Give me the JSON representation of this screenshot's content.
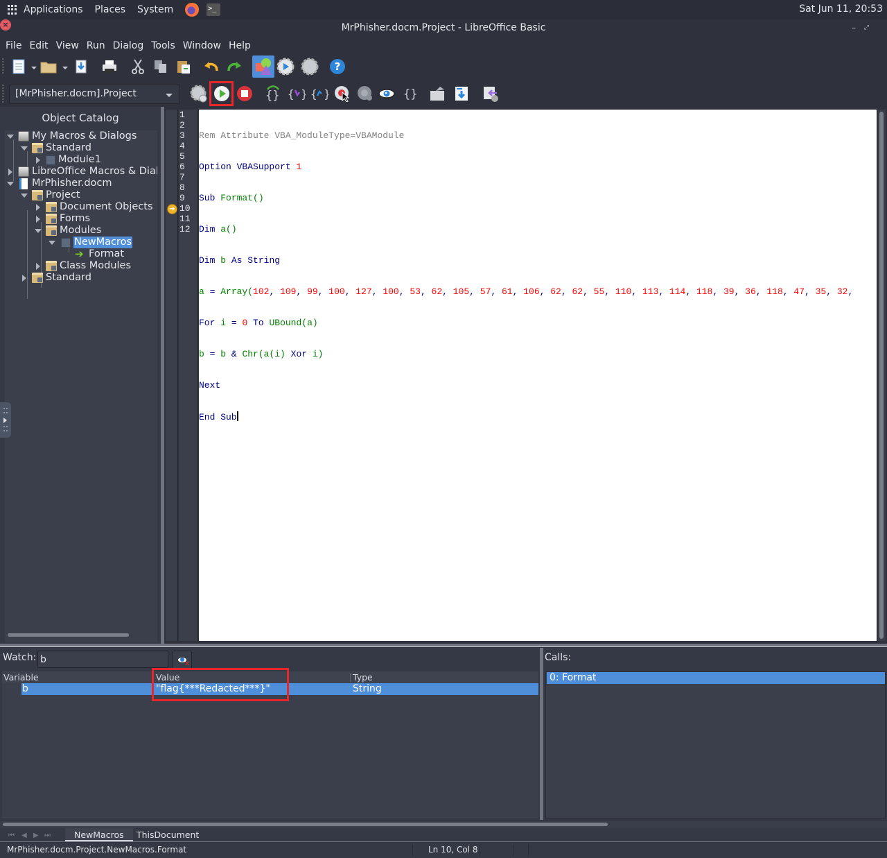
{
  "top_panel": {
    "menus": [
      "Applications",
      "Places",
      "System"
    ],
    "clock": "Sat Jun 11, 20:53"
  },
  "window": {
    "title": "MrPhisher.docm.Project - LibreOffice Basic",
    "minimize": "–",
    "maximize": "⤢",
    "close": "×"
  },
  "menubar": [
    "File",
    "Edit",
    "View",
    "Run",
    "Dialog",
    "Tools",
    "Window",
    "Help"
  ],
  "toolbar2": {
    "library_selected": "[MrPhisher.docm].Project"
  },
  "catalog": {
    "title": "Object Catalog",
    "nodes": [
      {
        "label": "My Macros & Dialogs",
        "state": "open",
        "icon": "drive-icon"
      },
      {
        "label": "Standard",
        "state": "open",
        "icon": "library-folder-icon"
      },
      {
        "label": "Module1",
        "state": "closed",
        "icon": "module-icon"
      },
      {
        "label": "LibreOffice Macros & Dialo",
        "state": "closed",
        "icon": "drive-icon"
      },
      {
        "label": "MrPhisher.docm",
        "state": "open",
        "icon": "document-icon"
      },
      {
        "label": "Project",
        "state": "open",
        "icon": "library-folder-icon"
      },
      {
        "label": "Document Objects",
        "state": "closed",
        "icon": "library-folder-icon"
      },
      {
        "label": "Forms",
        "state": "closed",
        "icon": "library-folder-icon"
      },
      {
        "label": "Modules",
        "state": "open",
        "icon": "library-folder-icon"
      },
      {
        "label": "NewMacros",
        "state": "open",
        "icon": "module-icon",
        "selected": true
      },
      {
        "label": "Format",
        "state": "leaf",
        "icon": "macro-arrow-icon"
      },
      {
        "label": "Class Modules",
        "state": "closed",
        "icon": "library-folder-icon"
      },
      {
        "label": "Standard",
        "state": "closed",
        "icon": "library-folder-icon"
      }
    ]
  },
  "editor": {
    "line_numbers": [
      "1",
      "2",
      "3",
      "4",
      "5",
      "6",
      "7",
      "8",
      "9",
      "10",
      "11",
      "12"
    ],
    "current_line": 10,
    "array_values": [
      102,
      109,
      99,
      100,
      127,
      100,
      53,
      62,
      105,
      57,
      61,
      106,
      62,
      62,
      55,
      110,
      113,
      114,
      118,
      39,
      36,
      118,
      47,
      35,
      32
    ],
    "tokens": {
      "l1": "Rem Attribute VBA_ModuleType=VBAModule",
      "l2_kw": "Option VBASupport ",
      "l2_num": "1",
      "l3_kw": "Sub ",
      "l3_id": "Format()",
      "l4_kw": "Dim ",
      "l4_id": "a()",
      "l5_kw": "Dim ",
      "l5_id": "b",
      "l5_kw2": " As String",
      "l6_id": "a",
      "l6_op": " = ",
      "l6_fn": "Array(",
      "l7_kw": "For ",
      "l7_id": "i",
      "l7_op": " = ",
      "l7_num": "0",
      "l7_kw2": " To ",
      "l7_fn": "UBound(a)",
      "l8_id": "b",
      "l8_op": " = ",
      "l8_id2": "b",
      "l8_op2": " & ",
      "l8_fn": "Chr(a(i) ",
      "l8_kw": "Xor",
      "l8_fn2": " i)",
      "l9_kw": "Next",
      "l10_kw": "End Sub"
    }
  },
  "watch": {
    "label": "Watch:",
    "input_value": "b",
    "columns": [
      "Variable",
      "Value",
      "Type"
    ],
    "rows": [
      {
        "variable": "b",
        "value": "\"flag{***Redacted***}\"",
        "type": "String"
      }
    ]
  },
  "calls": {
    "label": "Calls:",
    "items": [
      "0: Format"
    ]
  },
  "tabs": [
    "NewMacros",
    "ThisDocument"
  ],
  "status": {
    "path": "MrPhisher.docm.Project.NewMacros.Format",
    "position": "Ln 10, Col 8"
  }
}
